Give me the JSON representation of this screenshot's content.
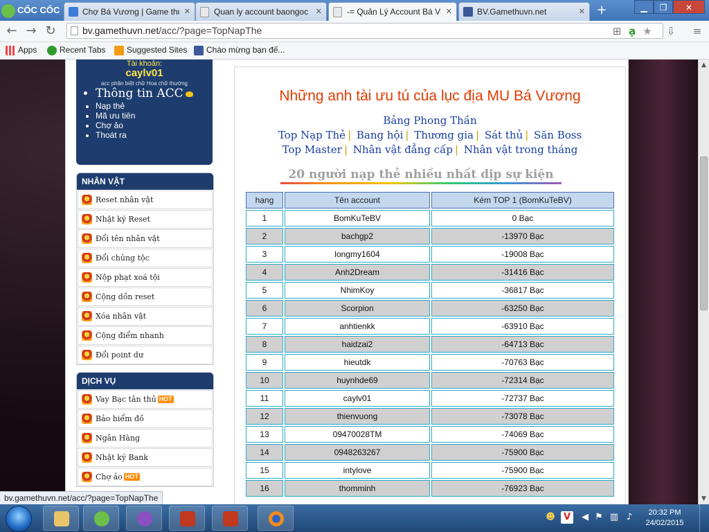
{
  "browser": {
    "brand": "CỐC CỐC",
    "tabs": [
      {
        "label": "Chợ Bá Vương | Game thủ",
        "favicon_color": "#3b7dd8"
      },
      {
        "label": "Quan ly account baongoc",
        "favicon_color": "#e8e8e8"
      },
      {
        "label": "-= Quản Lý Account Bá Vương",
        "favicon_color": "#e8e8e8"
      },
      {
        "label": "BV.Gamethuvn.net",
        "favicon_color": "#3b5998"
      }
    ],
    "url_host": "bv.gamethuvn.net",
    "url_path": "/acc/?page=TopNapThe",
    "bookmarks": [
      {
        "label": "Apps",
        "icon": "apps-grid-icon"
      },
      {
        "label": "Recent Tabs",
        "icon": "recent-tabs-icon"
      },
      {
        "label": "Suggested Sites",
        "icon": "suggested-sites-icon"
      },
      {
        "label": "Chào mừng bạn đế...",
        "icon": "facebook-icon"
      }
    ],
    "status_url": "bv.gamethuvn.net/acc/?page=TopNapThe"
  },
  "account": {
    "label": "Tài khoản:",
    "username": "caylv01",
    "note": "acc phân biệt chữ Hoa chữ thường",
    "menu": [
      "Thông tin ACC",
      "Nạp thẻ",
      "Mã ưu tiên",
      "Chợ ảo",
      "Thoát ra"
    ]
  },
  "nhan_vat": {
    "title": "NHÂN VẬT",
    "items": [
      "Reset nhân vật",
      "Nhật ký Reset",
      "Đổi tên nhân vật",
      "Đổi chủng tộc",
      "Nộp phạt xoá tội",
      "Cộng dồn reset",
      "Xóa nhân vật",
      "Cộng điểm nhanh",
      "Đổi point dư"
    ]
  },
  "dich_vu": {
    "title": "DỊCH VỤ",
    "items": [
      {
        "label": "Vay Bạc tân thủ",
        "badge": "HOT"
      },
      {
        "label": "Bảo hiểm đồ",
        "badge": ""
      },
      {
        "label": "Ngân Hàng",
        "badge": ""
      },
      {
        "label": "Nhật ký Bank",
        "badge": ""
      },
      {
        "label": "Chợ ảo",
        "badge": "HOT"
      }
    ]
  },
  "main": {
    "headline": "Những anh tài ưu tú của lục địa MU Bá Vương",
    "nav_title": "Bảng Phong Thần",
    "nav_row1": [
      "Top Nạp Thẻ",
      "Bang hội",
      "Thương gia",
      "Sát thủ",
      "Săn Boss"
    ],
    "nav_row2": [
      "Top Master",
      "Nhân vật đẳng cấp",
      "Nhân vật trong tháng"
    ],
    "table_title": "20 người nạp thẻ nhiều nhất dịp sự kiện",
    "columns": [
      "hạng",
      "Tên account",
      "Kém TOP 1 (BomKuTeBV)"
    ],
    "rows": [
      [
        "1",
        "BomKuTeBV",
        "0 Bạc"
      ],
      [
        "2",
        "bachgp2",
        "-13970 Bạc"
      ],
      [
        "3",
        "longmy1604",
        "-19008 Bạc"
      ],
      [
        "4",
        "Anh2Dream",
        "-31416 Bạc"
      ],
      [
        "5",
        "NhimKoy",
        "-36817 Bạc"
      ],
      [
        "6",
        "Scorpion",
        "-63250 Bạc"
      ],
      [
        "7",
        "anhtienkk",
        "-63910 Bạc"
      ],
      [
        "8",
        "haidzai2",
        "-64713 Bạc"
      ],
      [
        "9",
        "hieutdk",
        "-70763 Bạc"
      ],
      [
        "10",
        "huynhde69",
        "-72314 Bạc"
      ],
      [
        "11",
        "caylv01",
        "-72737 Bạc"
      ],
      [
        "12",
        "thienvuong",
        "-73078 Bạc"
      ],
      [
        "13",
        "09470028TM",
        "-74069 Bạc"
      ],
      [
        "14",
        "0948263267",
        "-75900 Bạc"
      ],
      [
        "15",
        "intylove",
        "-75900 Bạc"
      ],
      [
        "16",
        "thomminh",
        "-76923 Bạc"
      ]
    ]
  },
  "taskbar": {
    "time": "20:32 PM",
    "date": "24/02/2015"
  }
}
